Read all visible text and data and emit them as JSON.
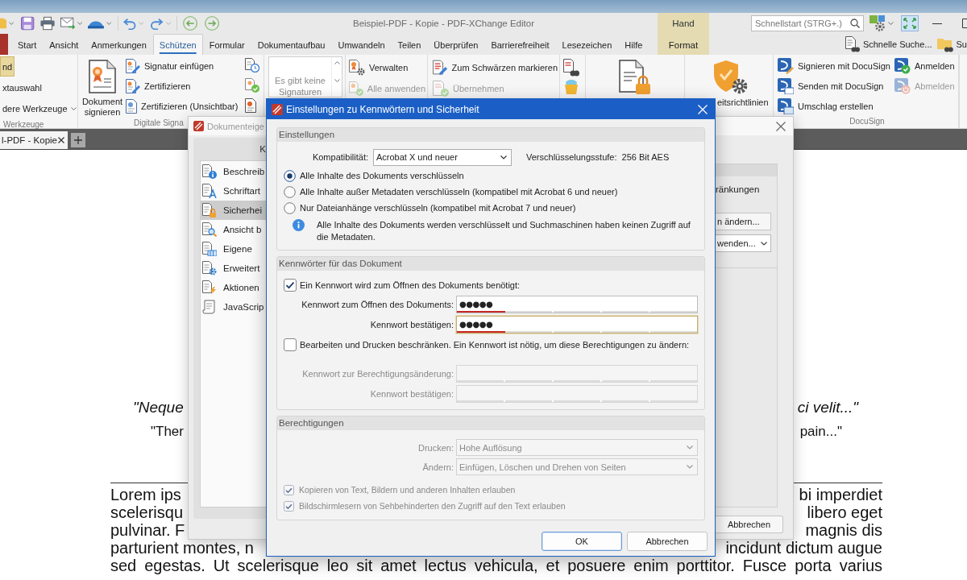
{
  "window": {
    "title": "Beispiel-PDF - Kopie - PDF-XChange Editor",
    "search": {
      "placeholder": "Schnellstart (STRG+.)"
    }
  },
  "ribbon_tabs": [
    {
      "label": "Start",
      "selected": false
    },
    {
      "label": "Ansicht",
      "selected": false
    },
    {
      "label": "Anmerkungen",
      "selected": false
    },
    {
      "label": "Schützen",
      "selected": true
    },
    {
      "label": "Formular",
      "selected": false
    },
    {
      "label": "Dokumentaufbau",
      "selected": false
    },
    {
      "label": "Umwandeln",
      "selected": false
    },
    {
      "label": "Teilen",
      "selected": false
    },
    {
      "label": "Überprüfen",
      "selected": false
    },
    {
      "label": "Barrierefreiheit",
      "selected": false
    },
    {
      "label": "Lesezeichen",
      "selected": false
    },
    {
      "label": "Hilfe",
      "selected": false
    }
  ],
  "contextual_tabs": {
    "group": "Hand",
    "tabs": [
      {
        "label": "Format",
        "selected": false
      }
    ]
  },
  "quick_find": [
    {
      "label": "Schnelle Suche..."
    },
    {
      "label": "Su"
    }
  ],
  "ribbon": {
    "tools": {
      "label": "Werkzeuge",
      "items": [
        {
          "label": "nd",
          "selected": true,
          "dropdown": false
        },
        {
          "label": "xtauswahl",
          "selected": false,
          "dropdown": false
        },
        {
          "label": "dere Werkzeuge",
          "selected": false,
          "dropdown": true
        }
      ]
    },
    "signatures": {
      "label": "Digitale Signa",
      "large_button": "Dokument signieren",
      "items": [
        {
          "label": "Signatur einfügen"
        },
        {
          "label": "Zertifizieren"
        },
        {
          "label": "Zertifizieren (Unsichtbar)"
        }
      ],
      "gallery_message": "Es gibt keine Signaturen"
    },
    "manage": [
      {
        "label": "Verwalten",
        "disabled": false
      },
      {
        "label": "Alle anwenden",
        "disabled": true
      }
    ],
    "redaction": [
      {
        "label": "Zum Schwärzen markieren",
        "disabled": false
      },
      {
        "label": "Übernehmen",
        "disabled": true
      }
    ],
    "security_policies": {
      "label": "eitsrichtlinien"
    },
    "docusign": {
      "label": "DocuSign",
      "items": [
        {
          "label": "Signieren mit DocuSign",
          "disabled": false
        },
        {
          "label": "Senden mit DocuSign",
          "disabled": false
        },
        {
          "label": "Umschlag erstellen",
          "disabled": false
        },
        {
          "label": "Anmelden",
          "disabled": false
        },
        {
          "label": "Abmelden",
          "disabled": true
        }
      ]
    }
  },
  "document_tabs": [
    {
      "label": "l-PDF - Kopie",
      "selected": true
    }
  ],
  "document": {
    "quote_lines": [
      {
        "left": "\"Neque",
        "right": "ci velit...\"",
        "kind": "italic"
      },
      {
        "left": "\"Ther",
        "right": "pain...\"",
        "kind": "plain"
      }
    ],
    "paragraph_lines": [
      {
        "left": "Lorem ips",
        "right": "bi imperdiet"
      },
      {
        "left": "scelerisqu",
        "right": "libero eget"
      },
      {
        "left": "pulvinar. F",
        "right": "magnis dis"
      },
      {
        "left": "parturient montes, n",
        "right": "incidunt dictum augue"
      },
      {
        "left": "sed egestas. Ut scelerisque leo sit amet lectus vehicula, et posuere enim porttitor. Fusce porta varius"
      }
    ]
  },
  "properties_dialog": {
    "title": "Dokumenteige",
    "list_header": "K",
    "categories": [
      {
        "label": "Beschreib",
        "selected": false
      },
      {
        "label": "Schriftart",
        "selected": false
      },
      {
        "label": "Sicherhei",
        "selected": true
      },
      {
        "label": "Ansicht b",
        "selected": false
      },
      {
        "label": "Eigene",
        "selected": false
      },
      {
        "label": "Erweitert",
        "selected": false
      },
      {
        "label": "Aktionen",
        "selected": false
      },
      {
        "label": "JavaScrip",
        "selected": false
      }
    ],
    "restrictions_label": "ränkungen",
    "change_button": "n ändern...",
    "apply_select": "wenden...",
    "cancel_button": "Abbrechen"
  },
  "security_dialog": {
    "title": "Einstellungen zu Kennwörtern und Sicherheit",
    "settings": {
      "heading": "Einstellungen",
      "compatibility": {
        "label": "Kompatibilität:",
        "value": "Acrobat X und neuer"
      },
      "encryption": {
        "label": "Verschlüsselungsstufe:",
        "value": "256 Bit AES"
      },
      "options": [
        {
          "label": "Alle Inhalte des Dokuments verschlüsseln",
          "selected": true
        },
        {
          "label": "Alle Inhalte außer Metadaten verschlüsseln (kompatibel mit Acrobat 6 und neuer)",
          "selected": false
        },
        {
          "label": "Nur Dateianhänge verschlüsseln (kompatibel mit Acrobat 7 und neuer)",
          "selected": false
        }
      ],
      "info": "Alle Inhalte des Dokuments werden verschlüsselt und Suchmaschinen haben keinen Zugriff auf die Metadaten."
    },
    "passwords": {
      "heading": "Kennwörter für das Dokument",
      "open_password": {
        "label": "Ein Kennwort wird zum Öffnen des Dokuments benötigt:",
        "checked": true,
        "fields": [
          {
            "label": "Kennwort zum Öffnen des Dokuments:",
            "value": "●●●●●",
            "level": 0.2,
            "focused": false,
            "disabled": false
          },
          {
            "label": "Kennwort bestätigen:",
            "value": "●●●●●",
            "level": 0.2,
            "focused": true,
            "disabled": false
          }
        ]
      },
      "permissions_password": {
        "label": "Bearbeiten und Drucken beschränken. Ein Kennwort ist nötig, um diese Berechtigungen zu ändern:",
        "checked": false,
        "fields": [
          {
            "label": "Kennwort zur Berechtigungsänderung:",
            "level": 0,
            "focused": false,
            "disabled": true
          },
          {
            "label": "Kennwort bestätigen:",
            "level": 0,
            "focused": false,
            "disabled": true
          }
        ]
      }
    },
    "permissions": {
      "heading": "Berechtigungen",
      "selects": [
        {
          "label": "Drucken:",
          "value": "Hohe Auflösung",
          "disabled": true
        },
        {
          "label": "Ändern:",
          "value": "Einfügen, Löschen und Drehen von Seiten",
          "disabled": true
        }
      ],
      "checks": [
        {
          "label": "Kopieren von Text, Bildern und anderen Inhalten erlauben",
          "checked": true,
          "disabled": true
        },
        {
          "label": "Bildschirmlesern von Sehbehinderten den Zugriff auf den Text erlauben",
          "checked": true,
          "disabled": true
        }
      ]
    },
    "buttons": [
      {
        "label": "OK",
        "default": true
      },
      {
        "label": "Abbrechen",
        "default": false
      }
    ]
  }
}
